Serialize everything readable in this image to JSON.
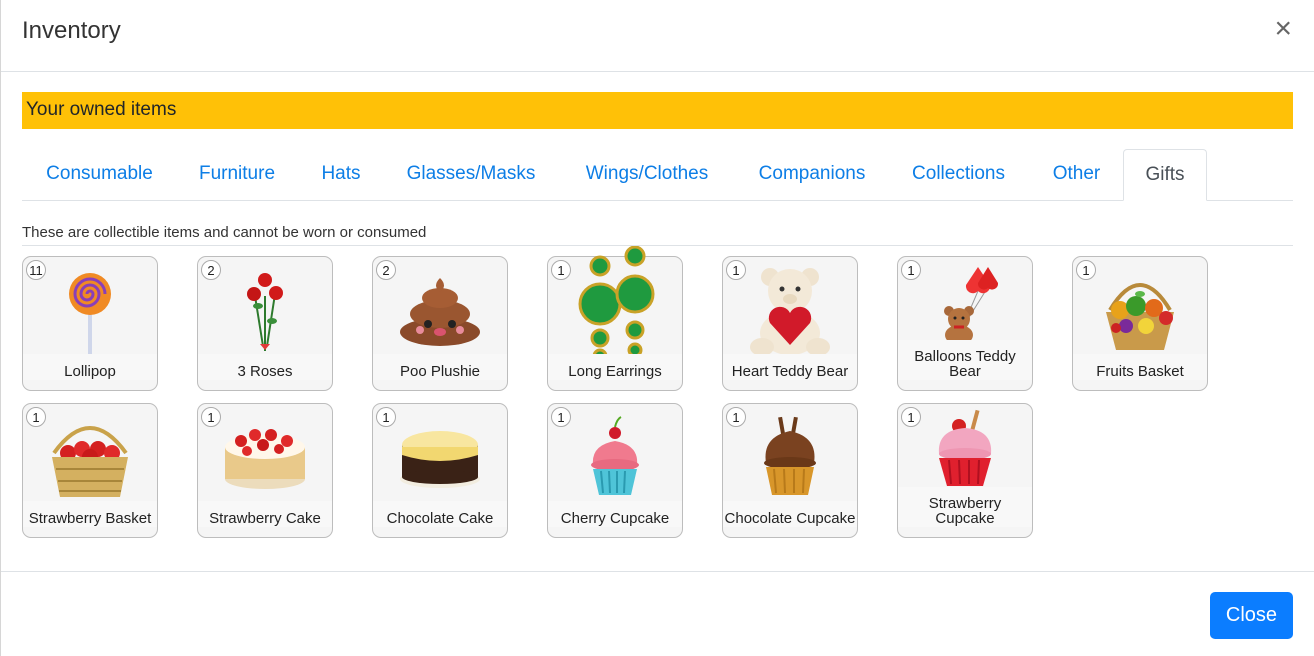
{
  "modal": {
    "title": "Inventory"
  },
  "banner": {
    "text": "Your owned items"
  },
  "tabs": [
    {
      "label": "Consumable"
    },
    {
      "label": "Furniture"
    },
    {
      "label": "Hats"
    },
    {
      "label": "Glasses/Masks"
    },
    {
      "label": "Wings/Clothes"
    },
    {
      "label": "Companions"
    },
    {
      "label": "Collections"
    },
    {
      "label": "Other"
    },
    {
      "label": "Gifts",
      "active": true
    }
  ],
  "note": "These are collectible items and cannot be worn or consumed",
  "items": [
    {
      "name": "Lollipop",
      "count": "11",
      "icon": "lollipop-icon"
    },
    {
      "name": "3 Roses",
      "count": "2",
      "icon": "roses-icon"
    },
    {
      "name": "Poo Plushie",
      "count": "2",
      "icon": "poo-plushie-icon"
    },
    {
      "name": "Long Earrings",
      "count": "1",
      "icon": "earrings-icon"
    },
    {
      "name": "Heart Teddy Bear",
      "count": "1",
      "icon": "heart-teddy-bear-icon"
    },
    {
      "name": "Balloons Teddy Bear",
      "count": "1",
      "icon": "balloons-teddy-bear-icon"
    },
    {
      "name": "Fruits Basket",
      "count": "1",
      "icon": "fruits-basket-icon"
    },
    {
      "name": "Strawberry Basket",
      "count": "1",
      "icon": "strawberry-basket-icon"
    },
    {
      "name": "Strawberry Cake",
      "count": "1",
      "icon": "strawberry-cake-icon"
    },
    {
      "name": "Chocolate Cake",
      "count": "1",
      "icon": "chocolate-cake-icon"
    },
    {
      "name": "Cherry Cupcake",
      "count": "1",
      "icon": "cherry-cupcake-icon"
    },
    {
      "name": "Chocolate Cupcake",
      "count": "1",
      "icon": "chocolate-cupcake-icon"
    },
    {
      "name": "Strawberry Cupcake",
      "count": "1",
      "icon": "strawberry-cupcake-icon"
    }
  ],
  "footer": {
    "close_label": "Close"
  },
  "colors": {
    "banner": "#ffc107",
    "link": "#0d7ee6",
    "primary_button": "#0b7dff"
  }
}
